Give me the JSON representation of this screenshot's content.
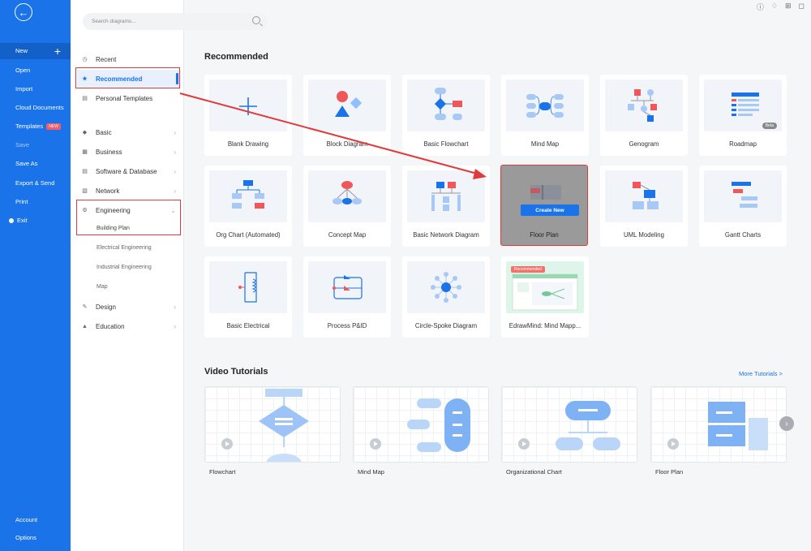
{
  "leftbar": {
    "items": [
      {
        "label": "New"
      },
      {
        "label": "Open"
      },
      {
        "label": "Import"
      },
      {
        "label": "Cloud Documents"
      },
      {
        "label": "Templates",
        "badge": "NEW"
      },
      {
        "label": "Save"
      },
      {
        "label": "Save As"
      },
      {
        "label": "Export & Send"
      },
      {
        "label": "Print"
      },
      {
        "label": "Exit"
      }
    ],
    "bottom": [
      {
        "label": "Account"
      },
      {
        "label": "Options"
      }
    ]
  },
  "categories": {
    "items": [
      {
        "label": "Recent",
        "icon": "clock-icon"
      },
      {
        "label": "Recommended",
        "icon": "star-icon"
      },
      {
        "label": "Personal Templates",
        "icon": "template-icon"
      },
      {
        "label": "Basic",
        "icon": "shapes-icon"
      },
      {
        "label": "Business",
        "icon": "chart-icon"
      },
      {
        "label": "Software & Database",
        "icon": "database-icon"
      },
      {
        "label": "Network",
        "icon": "network-icon"
      },
      {
        "label": "Engineering",
        "icon": "engineering-icon"
      },
      {
        "label": "Design",
        "icon": "pencil-icon"
      },
      {
        "label": "Education",
        "icon": "cap-icon"
      }
    ],
    "sub": [
      {
        "label": "Building Plan"
      },
      {
        "label": "Electrical Engineering"
      },
      {
        "label": "Industrial Engineering"
      },
      {
        "label": "Map"
      }
    ]
  },
  "search": {
    "placeholder": "Search diagrams..."
  },
  "recommended": {
    "title": "Recommended",
    "cards": [
      {
        "label": "Blank Drawing"
      },
      {
        "label": "Block Diagram"
      },
      {
        "label": "Basic Flowchart"
      },
      {
        "label": "Mind Map"
      },
      {
        "label": "Genogram"
      },
      {
        "label": "Roadmap",
        "badge": "Beta"
      },
      {
        "label": "Org Chart (Automated)"
      },
      {
        "label": "Concept Map"
      },
      {
        "label": "Basic Network Diagram"
      },
      {
        "label": "Floor Plan",
        "hover_button": "Create New"
      },
      {
        "label": "UML Modeling"
      },
      {
        "label": "Gantt Charts"
      },
      {
        "label": "Basic Electrical"
      },
      {
        "label": "Process P&ID"
      },
      {
        "label": "Circle-Spoke Diagram"
      },
      {
        "label": "EdrawMind: Mind Mapp...",
        "tag": "Recommended"
      }
    ]
  },
  "videos": {
    "title": "Video Tutorials",
    "more": "More Tutorials >",
    "items": [
      {
        "label": "Flowchart"
      },
      {
        "label": "Mind Map"
      },
      {
        "label": "Organizational Chart"
      },
      {
        "label": "Floor Plan"
      }
    ]
  },
  "colors": {
    "accent": "#1a73e8",
    "highlight": "#e03a3a",
    "sidebar": "#1a73e8"
  }
}
